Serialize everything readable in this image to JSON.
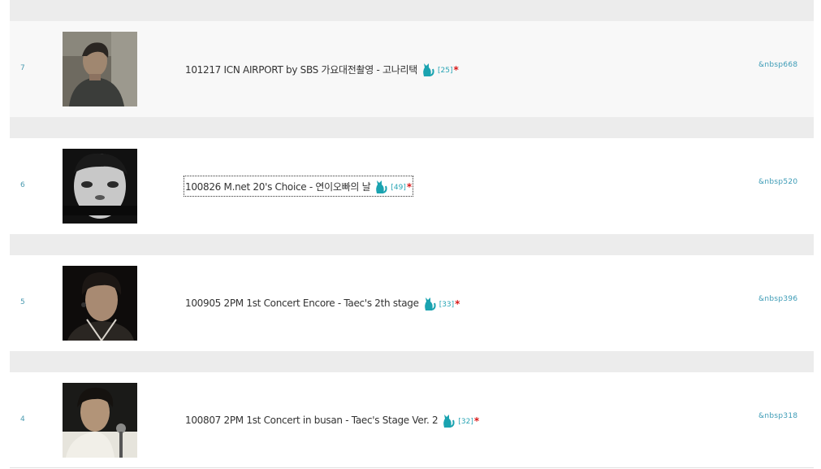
{
  "posts": [
    {
      "number": "7",
      "title": "101217 ICN AIRPORT by SBS 가요대전촬영 - 고나리택",
      "comment_count": "[25]",
      "new_marker": "*",
      "hits": "&nbsp668",
      "thumbnail": "photo-man-profile-dark-jacket"
    },
    {
      "number": "6",
      "title": "100826 M.net 20's Choice - 연이오빠의 날",
      "comment_count": "[49]",
      "new_marker": "*",
      "hits": "&nbsp520",
      "thumbnail": "photo-man-face-bw"
    },
    {
      "number": "5",
      "title": "100905 2PM 1st Concert Encore - Taec's 2th stage",
      "comment_count": "[33]",
      "new_marker": "*",
      "hits": "&nbsp396",
      "thumbnail": "photo-man-stage-earpiece"
    },
    {
      "number": "4",
      "title": "100807 2PM 1st Concert in busan - Taec's Stage Ver. 2",
      "comment_count": "[32]",
      "new_marker": "*",
      "hits": "&nbsp318",
      "thumbnail": "photo-man-microphone"
    }
  ],
  "icons": {
    "attachment": "cat-icon"
  },
  "colors": {
    "accent": "#2aa5b5",
    "new": "#d81818",
    "separator": "#ececec"
  }
}
